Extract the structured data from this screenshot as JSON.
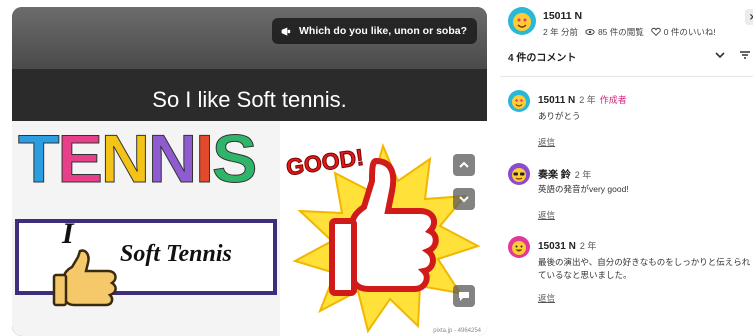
{
  "presentation": {
    "title": "Which do you like, unon or soba?",
    "slide_heading": "So I like Soft tennis.",
    "art": {
      "tennis_letters": [
        "T",
        "E",
        "N",
        "N",
        "I",
        "S"
      ],
      "tennis_colors": [
        "#2a9ee0",
        "#e83f8a",
        "#f3c318",
        "#8e5bd0",
        "#e24a2b",
        "#2fb56a"
      ],
      "good_text": "GOOD!",
      "i_letter": "I",
      "soft_tennis_text": "Soft Tennis"
    },
    "watermark": "pixta.jp - 4964254",
    "buttons": {
      "up_icon": "chevron-up-icon",
      "down_icon": "chevron-down-icon",
      "comment_icon": "comment-icon"
    }
  },
  "author": {
    "name": "15011 N",
    "time": "2 年 分前",
    "views": "85 件の閲覧",
    "likes": "0 件のいいね!",
    "close_label": "×"
  },
  "comments_header": {
    "count_label": "4 件のコメント"
  },
  "comments": [
    {
      "name": "15011 N",
      "time": "2 年",
      "badge": "作成者",
      "body": "ありがとう",
      "reply": "返信",
      "avatar_color": "#2bb7d6"
    },
    {
      "name": "奏楽 鈴",
      "time": "2 年",
      "badge": "",
      "body": "英語の発音がvery good!",
      "reply": "返信",
      "avatar_color": "#8a4bd1"
    },
    {
      "name": "15031 N",
      "time": "2 年",
      "badge": "",
      "body": "最後の演出や、自分の好きなものをしっかりと伝えられているなと思いました。",
      "reply": "返信",
      "avatar_color": "#e2389a"
    }
  ]
}
